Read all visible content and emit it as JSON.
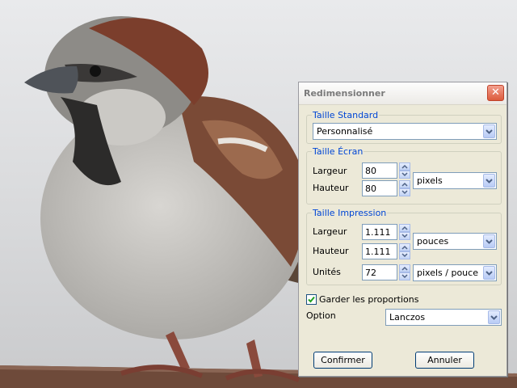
{
  "dialog": {
    "title": "Redimensionner",
    "close_icon": "close-icon",
    "standard_size": {
      "legend": "Taille Standard",
      "selected": "Personnalisé"
    },
    "screen_size": {
      "legend": "Taille Écran",
      "width_label": "Largeur",
      "width_value": "80",
      "height_label": "Hauteur",
      "height_value": "80",
      "unit_selected": "pixels"
    },
    "print_size": {
      "legend": "Taille Impression",
      "width_label": "Largeur",
      "width_value": "1.111",
      "height_label": "Hauteur",
      "height_value": "1.111",
      "unit_selected": "pouces",
      "resolution_label": "Unités",
      "resolution_value": "72",
      "resolution_unit_selected": "pixels / pouce"
    },
    "keep_proportions": {
      "label": "Garder les proportions",
      "checked": true
    },
    "option": {
      "label": "Option",
      "selected": "Lanczos"
    },
    "buttons": {
      "confirm": "Confirmer",
      "cancel": "Annuler"
    }
  },
  "background": {
    "subject": "sparrow-photo"
  },
  "colors": {
    "legend": "#0046d5",
    "close": "#dc5a3c",
    "check": "#21a121"
  }
}
